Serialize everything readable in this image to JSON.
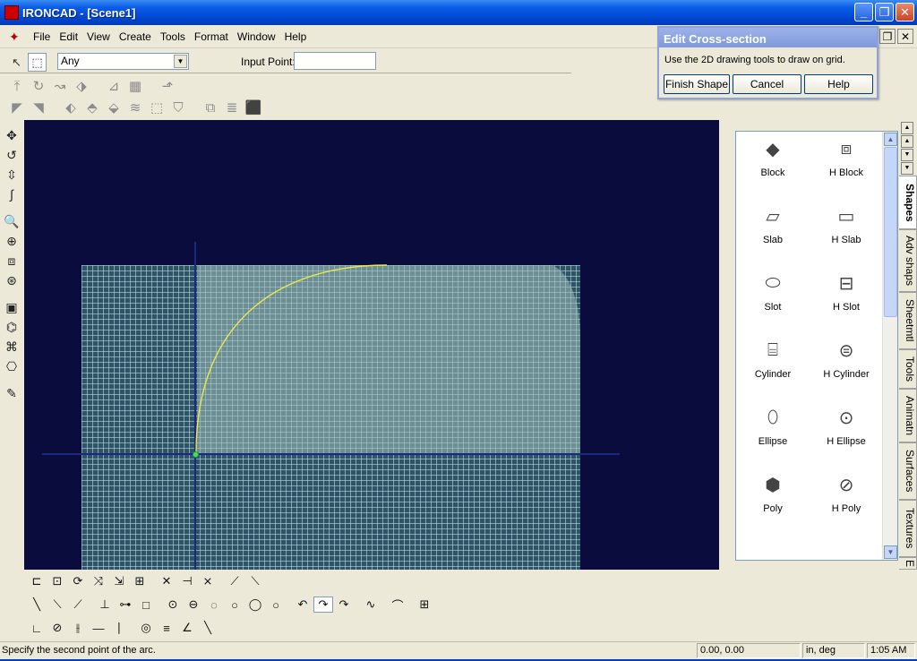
{
  "window": {
    "title": "IRONCAD - [Scene1]"
  },
  "menu": [
    "File",
    "Edit",
    "View",
    "Create",
    "Tools",
    "Format",
    "Window",
    "Help"
  ],
  "selection": {
    "filter_value": "Any",
    "input_point_label": "Input Point:",
    "input_point_value": ""
  },
  "dialog": {
    "title": "Edit Cross-section",
    "message": "Use the 2D drawing tools to draw on grid.",
    "buttons": [
      "Finish Shape",
      "Cancel",
      "Help"
    ]
  },
  "catalog": {
    "shapes": [
      {
        "label": "Block",
        "icon": "block-icon"
      },
      {
        "label": "H Block",
        "icon": "h-block-icon"
      },
      {
        "label": "Slab",
        "icon": "slab-icon"
      },
      {
        "label": "H Slab",
        "icon": "h-slab-icon"
      },
      {
        "label": "Slot",
        "icon": "slot-icon"
      },
      {
        "label": "H Slot",
        "icon": "h-slot-icon"
      },
      {
        "label": "Cylinder",
        "icon": "cylinder-icon"
      },
      {
        "label": "H Cylinder",
        "icon": "h-cylinder-icon"
      },
      {
        "label": "Ellipse",
        "icon": "ellipse-icon"
      },
      {
        "label": "H Ellipse",
        "icon": "h-ellipse-icon"
      },
      {
        "label": "Poly",
        "icon": "poly-icon"
      },
      {
        "label": "H Poly",
        "icon": "h-poly-icon"
      }
    ],
    "tabs": [
      "Shapes",
      "Adv shaps",
      "Sheetmtl",
      "Tools",
      "Animatn",
      "Surfaces",
      "Textures",
      "E"
    ],
    "active_tab": "Shapes"
  },
  "status": {
    "message": "Specify the second point of the arc.",
    "coordinates": "0.00, 0.00",
    "units": "in, deg",
    "time": "1:05 AM"
  },
  "viewport": {
    "background": "#0b0c3e",
    "grid_color": "#2e5468",
    "arc_color": "#e8e84a"
  }
}
